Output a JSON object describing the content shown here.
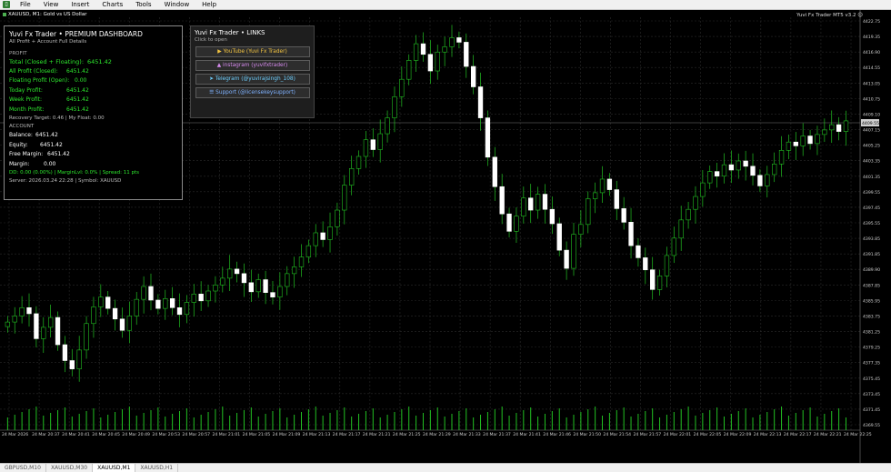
{
  "menubar": {
    "items": [
      "File",
      "View",
      "Insert",
      "Charts",
      "Tools",
      "Window",
      "Help"
    ]
  },
  "chart": {
    "title": "XAUUSD, M1:  Gold vs US Dollar",
    "ea_label": "Yuvi Fx Trader MT5 v3.2",
    "ea_icon": "smiley-icon",
    "current_price": "4409.55",
    "colors": {
      "grid": "#2a2a2a",
      "bull": "#22c022",
      "bear": "#ffffff",
      "axis_text": "#cfcfcf",
      "volume": "#22c022"
    }
  },
  "chart_data": {
    "type": "candlestick",
    "y_ticks": [
      "4422.75",
      "4419.35",
      "4416.90",
      "4414.55",
      "4413.05",
      "4410.75",
      "4409.10",
      "4407.15",
      "4405.25",
      "4403.35",
      "4401.35",
      "4399.55",
      "4397.45",
      "4395.55",
      "4393.85",
      "4391.85",
      "4389.90",
      "4387.85",
      "4385.95",
      "4383.75",
      "4381.25",
      "4379.25",
      "4377.35",
      "4375.45",
      "4373.45",
      "4371.45",
      "4369.55"
    ],
    "x_ticks": [
      "24 Mar 2026",
      "24 Mar 20:37",
      "24 Mar 20:41",
      "24 Mar 20:45",
      "24 Mar 20:49",
      "24 Mar 20:53",
      "24 Mar 20:57",
      "24 Mar 21:01",
      "24 Mar 21:05",
      "24 Mar 21:09",
      "24 Mar 21:13",
      "24 Mar 21:17",
      "24 Mar 21:21",
      "24 Mar 21:25",
      "24 Mar 21:29",
      "24 Mar 21:33",
      "24 Mar 21:37",
      "24 Mar 21:41",
      "24 Mar 21:46",
      "24 Mar 21:50",
      "24 Mar 21:54",
      "24 Mar 21:57",
      "24 Mar 22:01",
      "24 Mar 22:05",
      "24 Mar 22:09",
      "24 Mar 22:13",
      "24 Mar 22:17",
      "24 Mar 22:21",
      "24 Mar 22:25"
    ],
    "y_range": [
      4368.9,
      4423.5
    ],
    "closes": [
      4383.2,
      4384.0,
      4385.1,
      4384.3,
      4381.0,
      4382.5,
      4383.8,
      4380.2,
      4378.1,
      4377.0,
      4379.5,
      4383.0,
      4385.2,
      4386.5,
      4385.0,
      4383.6,
      4382.1,
      4384.0,
      4386.2,
      4387.9,
      4386.1,
      4385.0,
      4386.3,
      4385.1,
      4384.2,
      4385.8,
      4386.9,
      4386.0,
      4387.3,
      4388.1,
      4389.0,
      4390.2,
      4389.6,
      4388.4,
      4387.2,
      4388.8,
      4387.1,
      4386.5,
      4387.9,
      4389.6,
      4390.5,
      4391.8,
      4393.3,
      4395.0,
      4394.1,
      4395.8,
      4398.0,
      4401.3,
      4403.5,
      4405.1,
      4407.3,
      4406.0,
      4408.1,
      4410.2,
      4413.0,
      4415.3,
      4417.8,
      4420.0,
      4418.6,
      4416.4,
      4418.9,
      4419.6,
      4420.8,
      4420.2,
      4417.0,
      4414.3,
      4410.2,
      4405.0,
      4401.1,
      4397.5,
      4395.2,
      4397.2,
      4399.6,
      4398.0,
      4400.1,
      4398.1,
      4396.2,
      4392.7,
      4390.3,
      4394.8,
      4396.1,
      4399.5,
      4400.3,
      4402.1,
      4400.7,
      4398.2,
      4396.4,
      4393.3,
      4391.7,
      4390.1,
      4387.5,
      4389.3,
      4392.0,
      4394.3,
      4396.7,
      4398.1,
      4399.8,
      4401.6,
      4403.1,
      4402.5,
      4404.0,
      4403.3,
      4404.5,
      4403.8,
      4402.6,
      4401.2,
      4402.7,
      4404.1,
      4405.9,
      4407.0,
      4406.5,
      4407.8,
      4406.8,
      4408.0,
      4408.6,
      4409.3,
      4408.4,
      4409.8
    ]
  },
  "dashboard": {
    "title": "Yuvi Fx Trader • PREMIUM DASHBOARD",
    "subtitle": "All Profit + Account Full Details",
    "profit_header": "PROFIT",
    "total_label": "Total (Closed + Floating):",
    "total_value": "6451.42",
    "rows": [
      {
        "label": "All Profit (Closed):",
        "value": "6451.42"
      },
      {
        "label": "Floating Profit (Open):",
        "value": "0.00"
      },
      {
        "label": "Today Profit:",
        "value": "6451.42"
      },
      {
        "label": "Week Profit:",
        "value": "6451.42"
      },
      {
        "label": "Month Profit:",
        "value": "6451.42"
      }
    ],
    "recovery": "Recovery Target: 0.46 | My Float: 0.00",
    "account_header": "ACCOUNT",
    "account_rows": [
      {
        "label": "Balance:",
        "value": "6451.42"
      },
      {
        "label": "Equity:",
        "value": "6451.42"
      },
      {
        "label": "Free Margin:",
        "value": "6451.42"
      },
      {
        "label": "Margin:",
        "value": "0.00"
      }
    ],
    "dd_line": "DD: 0.00 (0.00%) | MarginLvl: 0.0% | Spread: 11 pts",
    "server_line": "Server: 2026.03.24 22:28 | Symbol: XAUUSD"
  },
  "links": {
    "title": "Yuvi Fx Trader • LINKS",
    "subtitle": "Click to open",
    "youtube": "▶ YouTube  (Yuvi Fx Trader)",
    "instagram": "▲ instagram (yuvifxtrader)",
    "telegram": "➤ Telegram  (@yuvirajsingh_108)",
    "support": "☰ Support  (@licensekeysupport)"
  },
  "tabs": [
    "GBPUSD,M10",
    "XAUUSD,M30",
    "XAUUSD,M1",
    "XAUUSD,H1"
  ],
  "active_tab": "XAUUSD,M1"
}
